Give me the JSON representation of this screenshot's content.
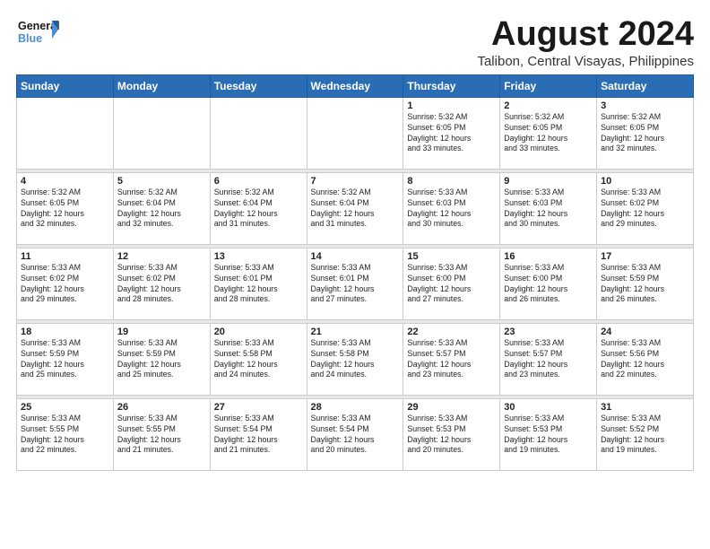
{
  "logo": {
    "general": "General",
    "blue": "Blue"
  },
  "title": "August 2024",
  "subtitle": "Talibon, Central Visayas, Philippines",
  "days": [
    "Sunday",
    "Monday",
    "Tuesday",
    "Wednesday",
    "Thursday",
    "Friday",
    "Saturday"
  ],
  "weeks": [
    [
      {
        "day": "",
        "info": ""
      },
      {
        "day": "",
        "info": ""
      },
      {
        "day": "",
        "info": ""
      },
      {
        "day": "",
        "info": ""
      },
      {
        "day": "1",
        "info": "Sunrise: 5:32 AM\nSunset: 6:05 PM\nDaylight: 12 hours\nand 33 minutes."
      },
      {
        "day": "2",
        "info": "Sunrise: 5:32 AM\nSunset: 6:05 PM\nDaylight: 12 hours\nand 33 minutes."
      },
      {
        "day": "3",
        "info": "Sunrise: 5:32 AM\nSunset: 6:05 PM\nDaylight: 12 hours\nand 32 minutes."
      }
    ],
    [
      {
        "day": "4",
        "info": "Sunrise: 5:32 AM\nSunset: 6:05 PM\nDaylight: 12 hours\nand 32 minutes."
      },
      {
        "day": "5",
        "info": "Sunrise: 5:32 AM\nSunset: 6:04 PM\nDaylight: 12 hours\nand 32 minutes."
      },
      {
        "day": "6",
        "info": "Sunrise: 5:32 AM\nSunset: 6:04 PM\nDaylight: 12 hours\nand 31 minutes."
      },
      {
        "day": "7",
        "info": "Sunrise: 5:32 AM\nSunset: 6:04 PM\nDaylight: 12 hours\nand 31 minutes."
      },
      {
        "day": "8",
        "info": "Sunrise: 5:33 AM\nSunset: 6:03 PM\nDaylight: 12 hours\nand 30 minutes."
      },
      {
        "day": "9",
        "info": "Sunrise: 5:33 AM\nSunset: 6:03 PM\nDaylight: 12 hours\nand 30 minutes."
      },
      {
        "day": "10",
        "info": "Sunrise: 5:33 AM\nSunset: 6:02 PM\nDaylight: 12 hours\nand 29 minutes."
      }
    ],
    [
      {
        "day": "11",
        "info": "Sunrise: 5:33 AM\nSunset: 6:02 PM\nDaylight: 12 hours\nand 29 minutes."
      },
      {
        "day": "12",
        "info": "Sunrise: 5:33 AM\nSunset: 6:02 PM\nDaylight: 12 hours\nand 28 minutes."
      },
      {
        "day": "13",
        "info": "Sunrise: 5:33 AM\nSunset: 6:01 PM\nDaylight: 12 hours\nand 28 minutes."
      },
      {
        "day": "14",
        "info": "Sunrise: 5:33 AM\nSunset: 6:01 PM\nDaylight: 12 hours\nand 27 minutes."
      },
      {
        "day": "15",
        "info": "Sunrise: 5:33 AM\nSunset: 6:00 PM\nDaylight: 12 hours\nand 27 minutes."
      },
      {
        "day": "16",
        "info": "Sunrise: 5:33 AM\nSunset: 6:00 PM\nDaylight: 12 hours\nand 26 minutes."
      },
      {
        "day": "17",
        "info": "Sunrise: 5:33 AM\nSunset: 5:59 PM\nDaylight: 12 hours\nand 26 minutes."
      }
    ],
    [
      {
        "day": "18",
        "info": "Sunrise: 5:33 AM\nSunset: 5:59 PM\nDaylight: 12 hours\nand 25 minutes."
      },
      {
        "day": "19",
        "info": "Sunrise: 5:33 AM\nSunset: 5:59 PM\nDaylight: 12 hours\nand 25 minutes."
      },
      {
        "day": "20",
        "info": "Sunrise: 5:33 AM\nSunset: 5:58 PM\nDaylight: 12 hours\nand 24 minutes."
      },
      {
        "day": "21",
        "info": "Sunrise: 5:33 AM\nSunset: 5:58 PM\nDaylight: 12 hours\nand 24 minutes."
      },
      {
        "day": "22",
        "info": "Sunrise: 5:33 AM\nSunset: 5:57 PM\nDaylight: 12 hours\nand 23 minutes."
      },
      {
        "day": "23",
        "info": "Sunrise: 5:33 AM\nSunset: 5:57 PM\nDaylight: 12 hours\nand 23 minutes."
      },
      {
        "day": "24",
        "info": "Sunrise: 5:33 AM\nSunset: 5:56 PM\nDaylight: 12 hours\nand 22 minutes."
      }
    ],
    [
      {
        "day": "25",
        "info": "Sunrise: 5:33 AM\nSunset: 5:55 PM\nDaylight: 12 hours\nand 22 minutes."
      },
      {
        "day": "26",
        "info": "Sunrise: 5:33 AM\nSunset: 5:55 PM\nDaylight: 12 hours\nand 21 minutes."
      },
      {
        "day": "27",
        "info": "Sunrise: 5:33 AM\nSunset: 5:54 PM\nDaylight: 12 hours\nand 21 minutes."
      },
      {
        "day": "28",
        "info": "Sunrise: 5:33 AM\nSunset: 5:54 PM\nDaylight: 12 hours\nand 20 minutes."
      },
      {
        "day": "29",
        "info": "Sunrise: 5:33 AM\nSunset: 5:53 PM\nDaylight: 12 hours\nand 20 minutes."
      },
      {
        "day": "30",
        "info": "Sunrise: 5:33 AM\nSunset: 5:53 PM\nDaylight: 12 hours\nand 19 minutes."
      },
      {
        "day": "31",
        "info": "Sunrise: 5:33 AM\nSunset: 5:52 PM\nDaylight: 12 hours\nand 19 minutes."
      }
    ]
  ]
}
